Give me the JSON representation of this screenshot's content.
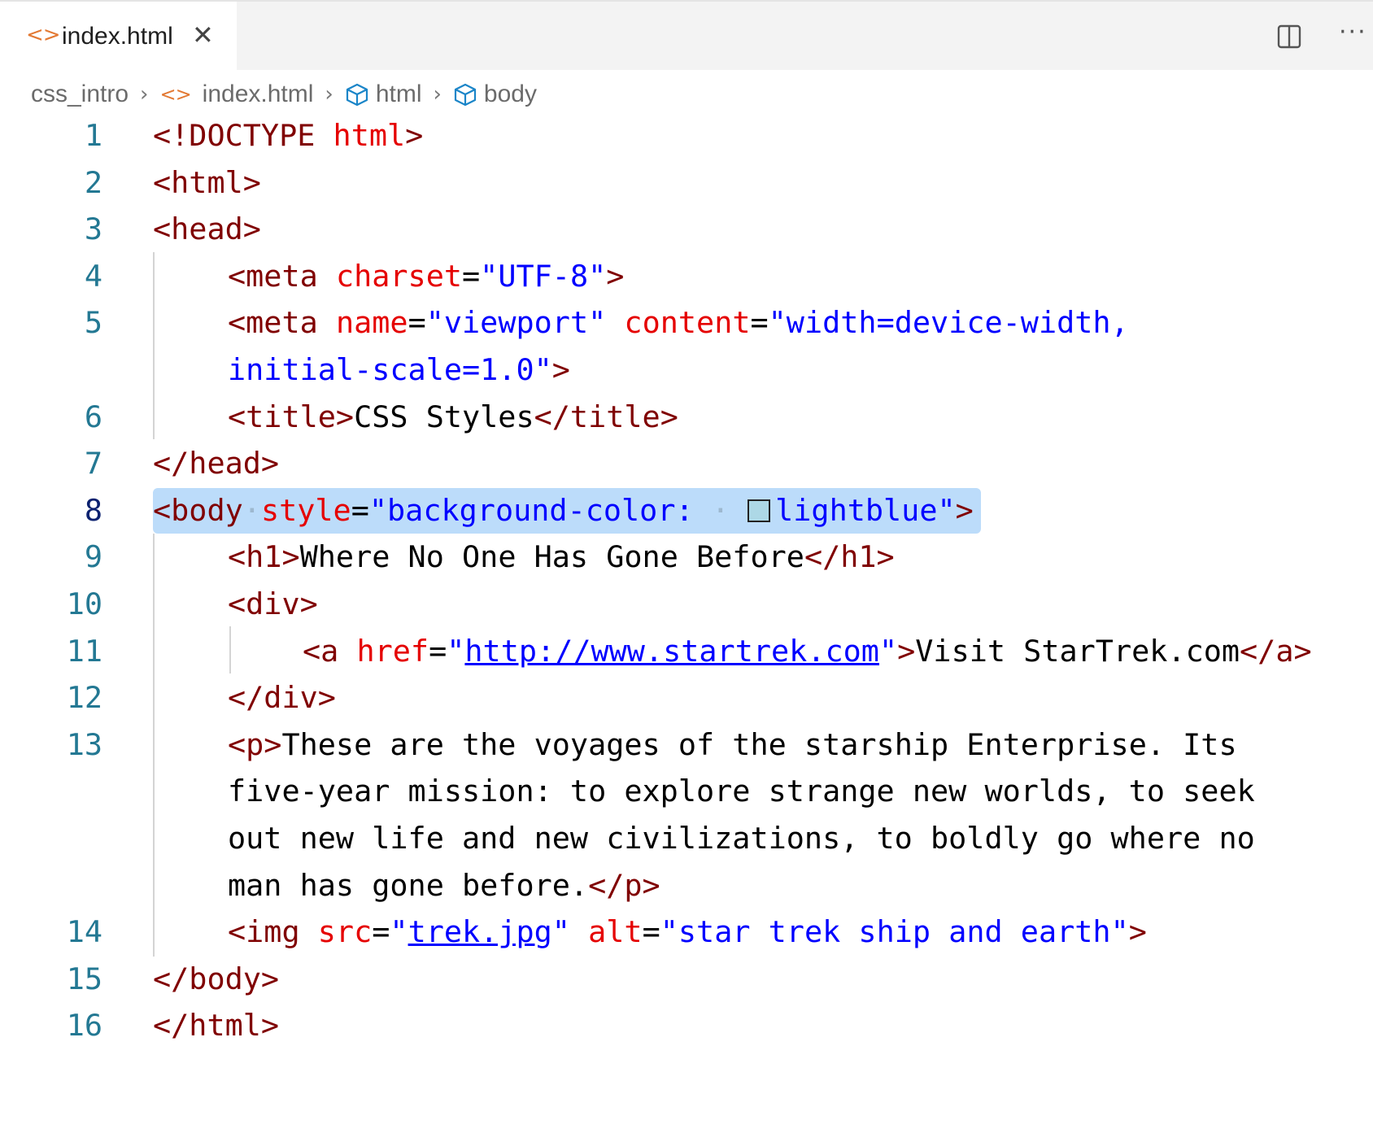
{
  "tab": {
    "label": "index.html",
    "icon": "html-file-icon"
  },
  "breadcrumb": {
    "folder": "css_intro",
    "file": "index.html",
    "el1": "html",
    "el2": "body"
  },
  "code": {
    "l1": {
      "n": "1",
      "p1": "<!DOCTYPE",
      "p2": " ",
      "p3": "html",
      "p4": ">"
    },
    "l2": {
      "n": "2",
      "p1": "<html>"
    },
    "l3": {
      "n": "3",
      "p1": "<head>"
    },
    "l4": {
      "n": "4",
      "p1": "<meta",
      "p2": " ",
      "p3": "charset",
      "p4": "=",
      "p5": "\"UTF-8\"",
      "p6": ">"
    },
    "l5": {
      "n": "5",
      "p1": "<meta",
      "p2": " ",
      "p3": "name",
      "p4": "=",
      "p5": "\"viewport\"",
      "p6": " ",
      "p7": "content",
      "p8": "=",
      "p9": "\"width=device-width,",
      "w": "initial-scale=1.0\"",
      "wt": ">"
    },
    "l6": {
      "n": "6",
      "p1": "<title>",
      "p2": "CSS Styles",
      "p3": "</title>"
    },
    "l7": {
      "n": "7",
      "p1": "</head>"
    },
    "l8": {
      "n": "8",
      "p1": "<body",
      "p2": "·",
      "p3": "style",
      "p4": "=",
      "p5": "\"background-color:",
      "p6": " · ",
      "p7": "lightblue\"",
      "p8": ">"
    },
    "l9": {
      "n": "9",
      "p1": "<h1>",
      "p2": "Where No One Has Gone Before",
      "p3": "</h1>"
    },
    "l10": {
      "n": "10",
      "p1": "<div>"
    },
    "l11": {
      "n": "11",
      "p1": "<a",
      "p2": " ",
      "p3": "href",
      "p4": "=",
      "p5": "\"",
      "p6": "http://www.startrek.com",
      "p7": "\"",
      "p8": ">",
      "p9": "Visit StarTrek.com",
      "p10": "</a>"
    },
    "l12": {
      "n": "12",
      "p1": "</div>"
    },
    "l13": {
      "n": "13",
      "p1": "<p>",
      "p2": "These are the voyages of the starship Enterprise. Its",
      "w1": "five-year mission: to explore strange new worlds, to seek",
      "w2": "out new life and new civilizations, to boldly go where no",
      "w3": "man has gone before.",
      "w3t": "</p>"
    },
    "l14": {
      "n": "14",
      "p1": "<img",
      "p2": " ",
      "p3": "src",
      "p4": "=",
      "p5": "\"",
      "p6": "trek.jpg",
      "p7": "\"",
      "p8": " ",
      "p9": "alt",
      "p10": "=",
      "p11": "\"star trek ship and earth\"",
      "p12": ">"
    },
    "l15": {
      "n": "15",
      "p1": "</body>"
    },
    "l16": {
      "n": "16",
      "p1": "</html>"
    }
  },
  "colors": {
    "tag": "#800000",
    "attr": "#e50000",
    "string": "#0000ff",
    "line_number": "#237893",
    "active_line": "#bcdcfa",
    "swatch": "#add8e6"
  }
}
